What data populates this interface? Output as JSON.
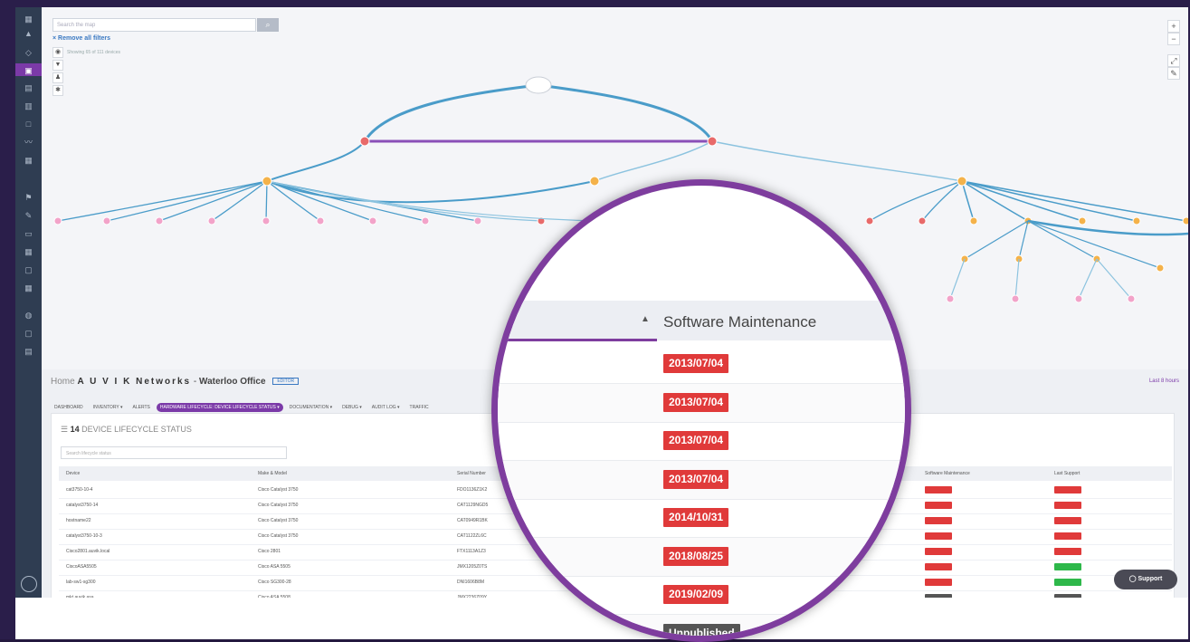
{
  "app": {
    "brand": "A U V I K Networks",
    "title": "Waterloo Office",
    "home": "Home",
    "badge": "EDITOR",
    "last_hours": "Last 8 hours"
  },
  "map": {
    "search_placeholder": "Search the map",
    "remove_filters": "× Remove all filters",
    "showing": "Showing 65 of 111 devices",
    "zoom_in": "+",
    "zoom_out": "−"
  },
  "tabs": [
    {
      "label": "DASHBOARD"
    },
    {
      "label": "INVENTORY ▾"
    },
    {
      "label": "ALERTS"
    },
    {
      "label": "HARDWARE LIFECYCLE: DEVICE LIFECYCLE STATUS ▾"
    },
    {
      "label": "DOCUMENTATION ▾"
    },
    {
      "label": "DEBUG ▾"
    },
    {
      "label": "AUDIT LOG ▾"
    },
    {
      "label": "TRAFFIC"
    }
  ],
  "table": {
    "count": "14",
    "title": "DEVICE LIFECYCLE STATUS",
    "filter_placeholder": "Search lifecycle status",
    "columns": {
      "device": "Device",
      "make_model": "Make & Model",
      "serial": "Serial Number",
      "software_maintenance": "Software Maintenance",
      "last_support": "Last Support"
    },
    "rows": [
      {
        "device": "cat3750-10-4",
        "model": "Cisco Catalyst 3750",
        "serial": "FDO1136Z1K2",
        "sw": "red",
        "ls": "red"
      },
      {
        "device": "catalyst3750-14",
        "model": "Cisco Catalyst 3750",
        "serial": "CAT1129NGD5",
        "sw": "red",
        "ls": "red"
      },
      {
        "device": "hostname22",
        "model": "Cisco Catalyst 3750",
        "serial": "CAT0949R1BK",
        "sw": "red",
        "ls": "red"
      },
      {
        "device": "catalyst3750-10-3",
        "model": "Cisco Catalyst 3750",
        "serial": "CAT1122ZL6C",
        "sw": "red",
        "ls": "red"
      },
      {
        "device": "Cisco2801.auvik.local",
        "model": "Cisco 2801",
        "serial": "FTX1113A1Z3",
        "sw": "red",
        "ls": "red"
      },
      {
        "device": "CiscoASA5505",
        "model": "Cisco ASA 5505",
        "serial": "JMX1205Z0TS",
        "sw": "red",
        "ls": "green"
      },
      {
        "device": "lab-sw1-sg300",
        "model": "Cisco SG300-28",
        "serial": "DNI1606B8M",
        "sw": "red",
        "ls": "green"
      },
      {
        "device": "mkt.auvik.asa",
        "model": "Cisco ASA 5508",
        "serial": "JMX2236Z09Y",
        "sw": "dark",
        "ls": "dark"
      }
    ]
  },
  "lens": {
    "header": "Software Maintenance",
    "sort_arrow": "▲",
    "dates": [
      "2013/07/04",
      "2013/07/04",
      "2013/07/04",
      "2013/07/04",
      "2014/10/31",
      "2018/08/25",
      "2019/02/09"
    ],
    "last": "Unpublished"
  },
  "support": {
    "label": "Support"
  },
  "colors": {
    "accent": "#7b3aa8",
    "alert_red": "#e03a3a",
    "ok_green": "#2eb84a",
    "link_blue": "#3a79c2"
  }
}
